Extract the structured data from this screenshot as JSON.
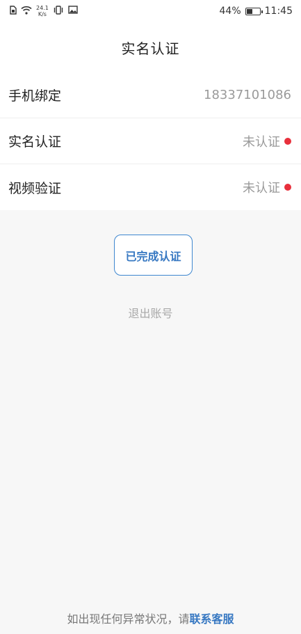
{
  "status_bar": {
    "net_speed_value": "24.1",
    "net_speed_unit": "K/s",
    "battery_percent": "44%",
    "battery_level": 0.44,
    "time": "11:45",
    "icons": [
      "sim-icon",
      "wifi-icon",
      "vibrate-icon",
      "gallery-icon",
      "battery-icon"
    ]
  },
  "header": {
    "title": "实名认证"
  },
  "list": {
    "items": [
      {
        "label": "手机绑定",
        "value": "18337101086",
        "pending": false
      },
      {
        "label": "实名认证",
        "value": "未认证",
        "pending": true
      },
      {
        "label": "视频验证",
        "value": "未认证",
        "pending": true
      }
    ]
  },
  "actions": {
    "certify_button": "已完成认证",
    "logout_link": "退出账号"
  },
  "footer": {
    "text": "如出现任何异常状况，请",
    "link": "联系客服"
  },
  "colors": {
    "accent": "#3778c2",
    "pending_dot": "#e8303c",
    "background": "#f7f7f7"
  }
}
